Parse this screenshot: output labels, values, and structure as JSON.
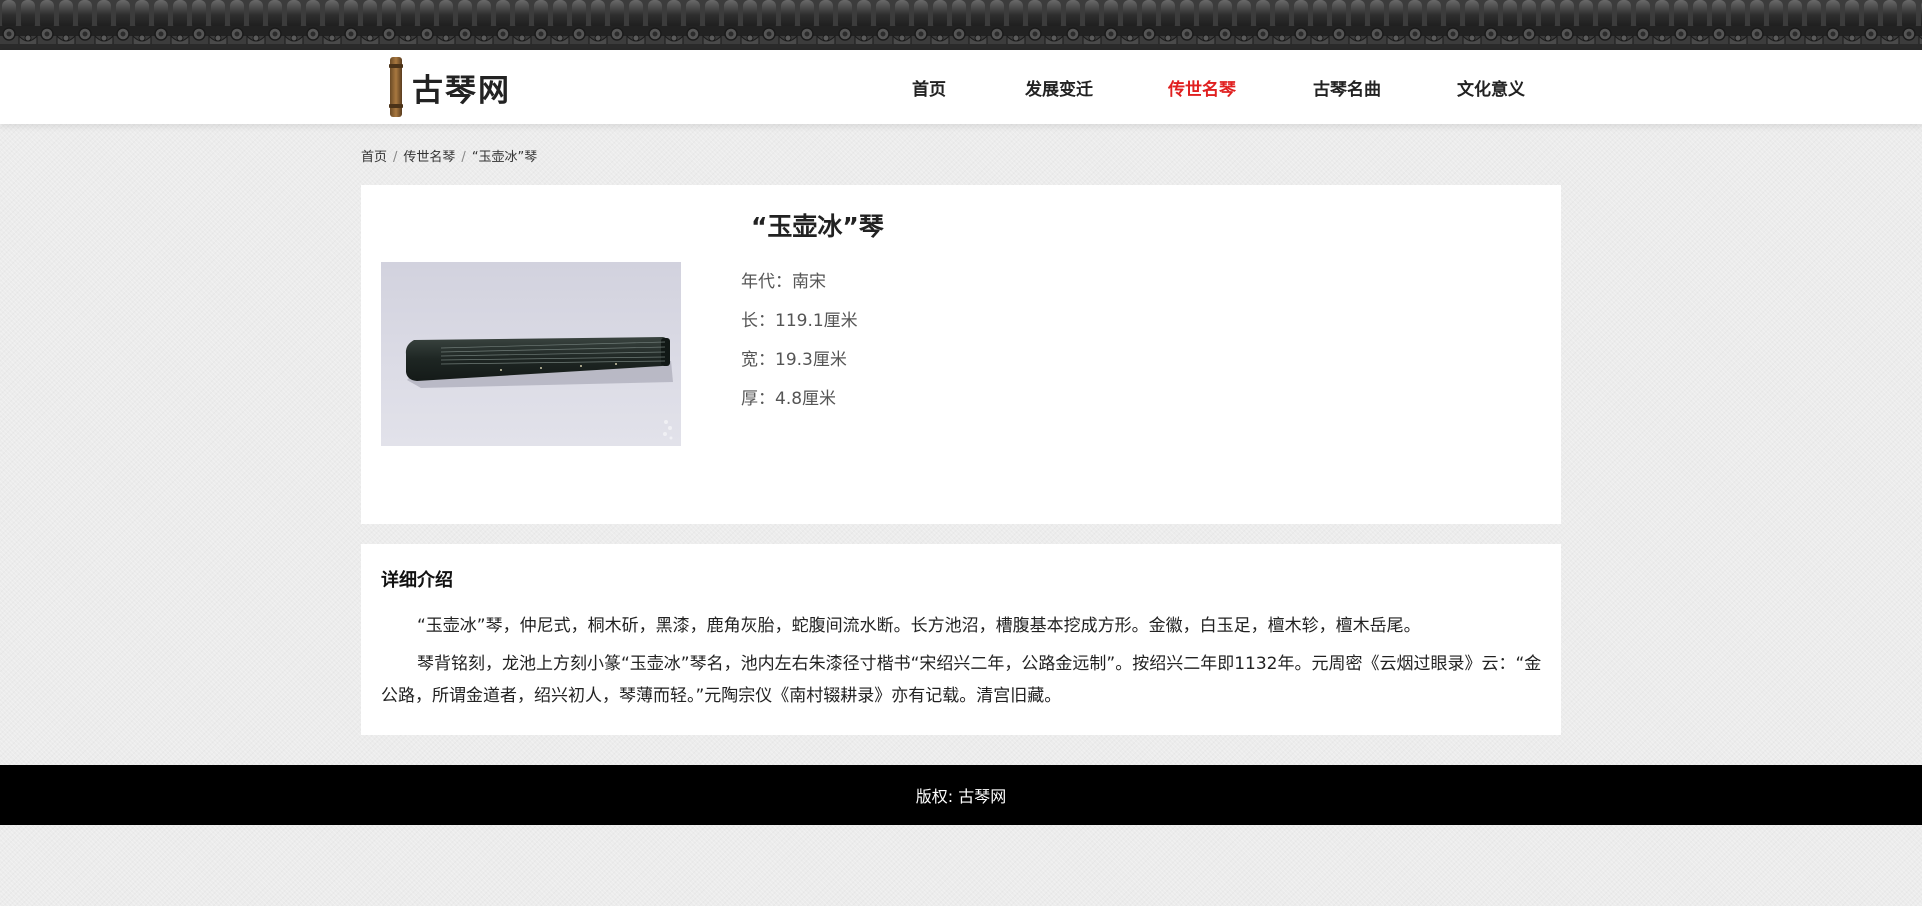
{
  "site": {
    "logo_text": "古琴网"
  },
  "nav": {
    "items": [
      {
        "label": "首页",
        "active": false
      },
      {
        "label": "发展变迁",
        "active": false
      },
      {
        "label": "传世名琴",
        "active": true
      },
      {
        "label": "古琴名曲",
        "active": false
      },
      {
        "label": "文化意义",
        "active": false
      }
    ]
  },
  "breadcrumb": {
    "home": "首页",
    "section": "传世名琴",
    "current": "“玉壶冰”琴",
    "separator": "/"
  },
  "qin": {
    "title": "“玉壶冰”琴",
    "attributes": [
      {
        "label": "年代",
        "value": "南宋",
        "text": "年代：南宋"
      },
      {
        "label": "长",
        "value": "119.1厘米",
        "text": "长：119.1厘米"
      },
      {
        "label": "宽",
        "value": "19.3厘米",
        "text": "宽：19.3厘米"
      },
      {
        "label": "厚",
        "value": "4.8厘米",
        "text": "厚：4.8厘米"
      }
    ]
  },
  "detail": {
    "heading": "详细介绍",
    "paragraphs": [
      "“玉壶冰”琴，仲尼式，桐木斫，黑漆，鹿角灰胎，蛇腹间流水断。长方池沼，槽腹基本挖成方形。金徽，白玉足，檀木轸，檀木岳尾。",
      "琴背铭刻，龙池上方刻小篆“玉壶冰”琴名，池内左右朱漆径寸楷书“宋绍兴二年，公路金远制”。按绍兴二年即1132年。元周密《云烟过眼录》云：“金公路，所谓金道者，绍兴初人，琴薄而轻。”元陶宗仪《南村辍耕录》亦有记载。清宫旧藏。"
    ]
  },
  "footer": {
    "copyright": "版权: 古琴网"
  },
  "colors": {
    "nav_active": "#e02020",
    "footer_bg": "#000000",
    "page_bg": "#ececec"
  }
}
